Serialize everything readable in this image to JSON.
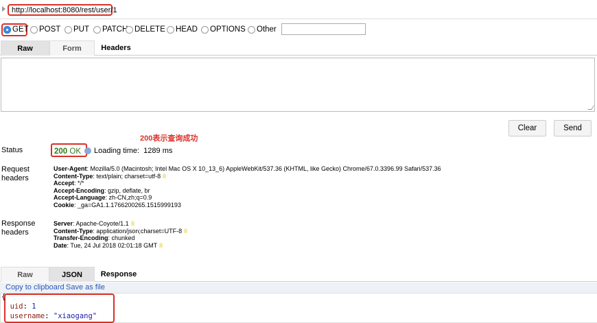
{
  "request": {
    "url": "http://localhost:8080/rest/user/1",
    "methods": [
      {
        "label": "GET",
        "checked": true
      },
      {
        "label": "POST",
        "checked": false
      },
      {
        "label": "PUT",
        "checked": false
      },
      {
        "label": "PATCH",
        "checked": false
      },
      {
        "label": "DELETE",
        "checked": false
      },
      {
        "label": "HEAD",
        "checked": false
      },
      {
        "label": "OPTIONS",
        "checked": false
      },
      {
        "label": "Other",
        "checked": false
      }
    ],
    "tabs": {
      "raw": "Raw",
      "form": "Form",
      "headers": "Headers"
    },
    "clear_label": "Clear",
    "send_label": "Send"
  },
  "annotation": "200表示查询成功",
  "status": {
    "label": "Status",
    "code": "200",
    "text": "OK",
    "loading_label": "Loading time:",
    "loading_value": "1289 ms"
  },
  "request_headers": {
    "label_line1": "Request",
    "label_line2": "headers",
    "items": [
      {
        "name": "User-Agent",
        "value": ": Mozilla/5.0 (Macintosh; Intel Mac OS X 10_13_6) AppleWebKit/537.36 (KHTML, like Gecko) Chrome/67.0.3396.99 Safari/537.36",
        "bulb": false
      },
      {
        "name": "Content-Type",
        "value": ": text/plain; charset=utf-8",
        "bulb": true
      },
      {
        "name": "Accept",
        "value": ": */*",
        "bulb": false
      },
      {
        "name": "Accept-Encoding",
        "value": ": gzip, deflate, br",
        "bulb": false
      },
      {
        "name": "Accept-Language",
        "value": ": zh-CN,zh;q=0.9",
        "bulb": false
      },
      {
        "name": "Cookie",
        "value": ": _ga=GA1.1.1766200265.1515999193",
        "bulb": false
      }
    ]
  },
  "response_headers": {
    "label_line1": "Response",
    "label_line2": "headers",
    "items": [
      {
        "name": "Server",
        "value": ": Apache-Coyote/1.1",
        "bulb": true
      },
      {
        "name": "Content-Type",
        "value": ": application/json;charset=UTF-8",
        "bulb": true
      },
      {
        "name": "Transfer-Encoding",
        "value": ": chunked",
        "bulb": false
      },
      {
        "name": "Date",
        "value": ": Tue, 24 Jul 2018 02:01:18 GMT",
        "bulb": true
      }
    ]
  },
  "response": {
    "tabs": {
      "raw": "Raw",
      "json": "JSON",
      "response": "Response"
    },
    "copy_label": "Copy to clipboard",
    "save_label": "Save as file",
    "json_open": "{",
    "fields": [
      {
        "key": "uid",
        "value": "1",
        "type": "number"
      },
      {
        "key": "username",
        "value": "\"xiaogang\"",
        "type": "string"
      }
    ]
  }
}
